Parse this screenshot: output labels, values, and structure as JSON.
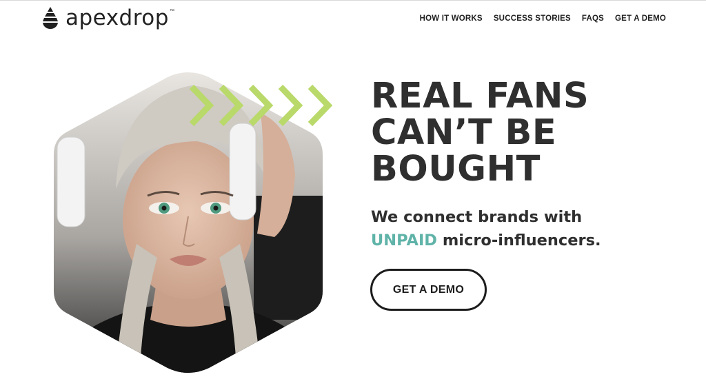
{
  "brand": {
    "name": "apexdrop",
    "tm": "™"
  },
  "nav": [
    {
      "label": "HOW IT WORKS"
    },
    {
      "label": "SUCCESS STORIES"
    },
    {
      "label": "FAQS"
    },
    {
      "label": "GET A DEMO"
    }
  ],
  "hero": {
    "headline_lines": [
      "REAL FANS",
      "CAN’T BE",
      "BOUGHT"
    ],
    "sub_line1": "We connect brands with",
    "sub_accent": "UNPAID",
    "sub_line2_rest": " micro-influencers.",
    "cta_label": "GET A DEMO",
    "image_icon": "woman-with-headphones-photo"
  },
  "colors": {
    "accent_teal": "#5fb3a8",
    "chevron_green": "#b9d96a",
    "text_dark": "#2f2f2f"
  }
}
